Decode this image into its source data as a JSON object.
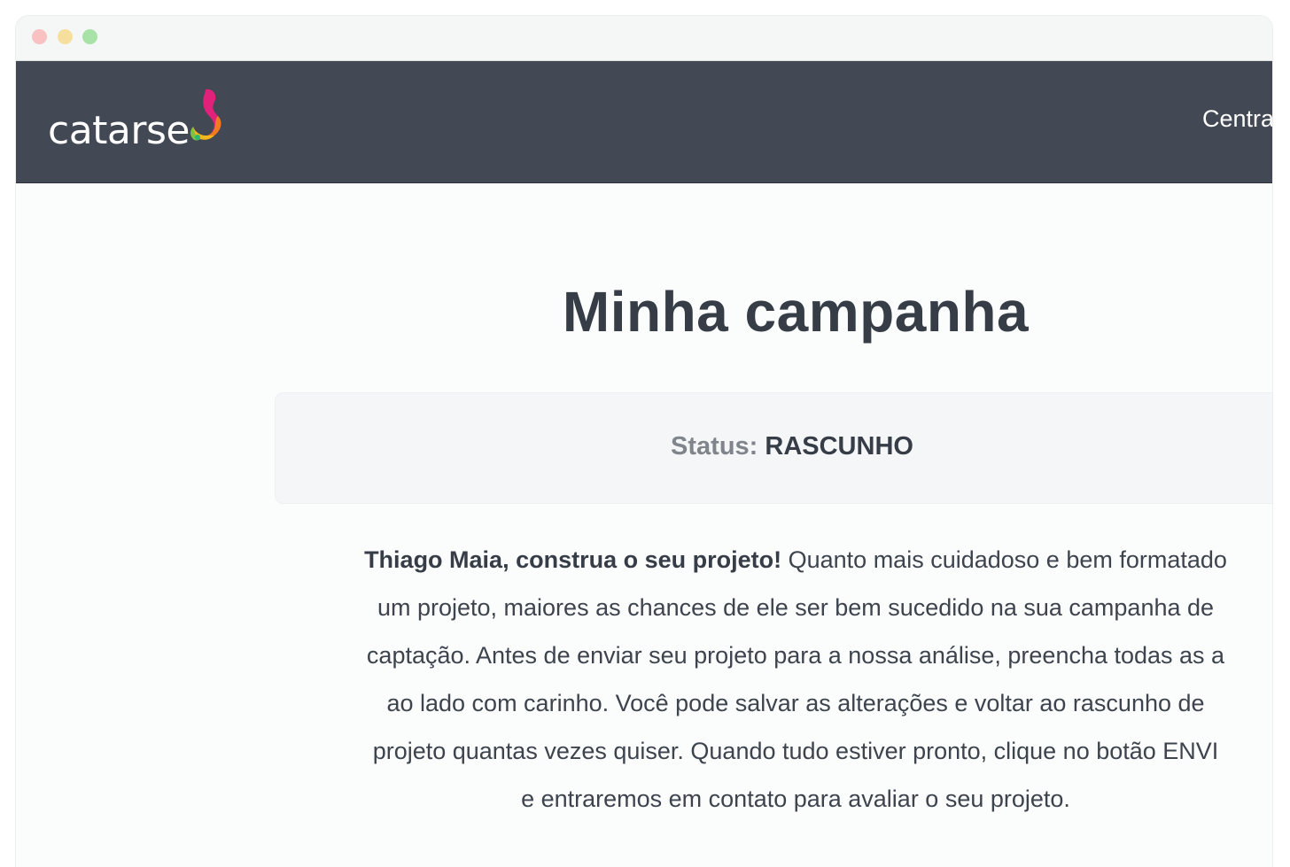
{
  "window": {
    "controls": [
      "close",
      "minimize",
      "maximize"
    ]
  },
  "header": {
    "logo_text": "catarse",
    "logo_icon": "catarse-swirl-icon",
    "nav_link": "Centra"
  },
  "main": {
    "title": "Minha campanha",
    "status": {
      "label": "Status:",
      "value": "RASCUNHO"
    },
    "intro": {
      "greeting": "Thiago Maia, construa o seu projeto!",
      "lines": [
        " Quanto mais cuidadoso e bem formatado",
        "um projeto, maiores as chances de ele ser bem sucedido na sua campanha de",
        "captação. Antes de enviar seu projeto para a nossa análise, preencha todas as a",
        "ao lado com carinho. Você pode salvar as alterações e voltar ao rascunho de",
        "projeto quantas vezes quiser. Quando tudo estiver pronto, clique no botão ENVI",
        "e entraremos em contato para avaliar o seu projeto."
      ]
    }
  },
  "colors": {
    "navbar_bg": "#424854",
    "title": "#373d47",
    "status_box_bg": "#f5f6f7"
  }
}
